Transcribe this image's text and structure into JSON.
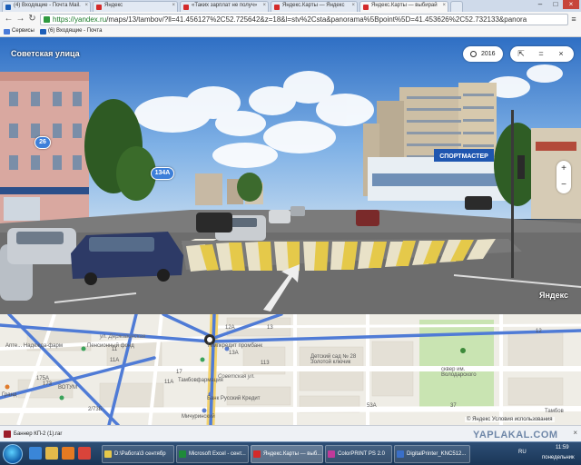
{
  "browser": {
    "tabs": [
      {
        "label": "(4) Входящие - Почта Mail.",
        "icon_color": "#1d5fb8",
        "active": false
      },
      {
        "label": "Яндекс",
        "icon_color": "#d42a2a",
        "active": false
      },
      {
        "label": "«Таких зарплат не получ»",
        "icon_color": "#d42a2a",
        "active": false
      },
      {
        "label": "Яндекс.Карты — Яндекс",
        "icon_color": "#d42a2a",
        "active": false
      },
      {
        "label": "Яндекс.Карты — выбирай",
        "icon_color": "#d42a2a",
        "active": true
      }
    ],
    "url_host": "https://yandex.ru",
    "url_path": "/maps/13/tambov/?ll=41.456127%2C52.725642&z=18&l=stv%2Csta&panorama%5Bpoint%5D=41.453626%2C52.732133&panora",
    "bookmarks": [
      {
        "label": "Сервисы",
        "icon_color": "#4a7bd8"
      },
      {
        "label": "(6) Входящие - Почта",
        "icon_color": "#1d5fb8"
      }
    ]
  },
  "panorama": {
    "street_title": "Советская улица",
    "year": "2016",
    "markers": [
      "26",
      "134А"
    ],
    "logo": "Яндекс",
    "store_sign": "СПОРТМАСТЕР"
  },
  "map": {
    "labels": [
      "12А",
      "13",
      "13А",
      "113",
      "11",
      "11А",
      "11А",
      "17",
      "173",
      "175А",
      "2/73Б",
      "53А",
      "37",
      "12",
      "Апте... Надежда-фарм",
      "Пенсионный фонд",
      "Темпкредит промбанк",
      "Детский сад № 28 Золотой ключик",
      "Тамбовфармация",
      "Банк Русский Кредит",
      "Мичуринский",
      "ВОТУМ",
      "сквер им. Володарского",
      "Гранд",
      "Тамбов"
    ],
    "street_labels": [
      "ул. Державинская",
      "Советская ул."
    ],
    "copyright": "© Яндекс Условия использования"
  },
  "download": {
    "file": "Баннер КП-2 (1).rar"
  },
  "taskbar": {
    "tasks": [
      {
        "label": "D:\\Работа\\3 сентябр",
        "icon_color": "#e6c84a",
        "active": false
      },
      {
        "label": "Microsoft Excel - сент...",
        "icon_color": "#1f8a3a",
        "active": false
      },
      {
        "label": "Яндекс.Карты — выб...",
        "icon_color": "#d42a2a",
        "active": true
      },
      {
        "label": "ColorPRINT PS 2.0",
        "icon_color": "#c03a9a",
        "active": false
      },
      {
        "label": "DigitalPrinter_KNC512...",
        "icon_color": "#3a6fc8",
        "active": false
      }
    ],
    "lang": "RU",
    "time": "11:59",
    "day": "понедельник",
    "watermark": "YAPLAKAL.COM"
  }
}
